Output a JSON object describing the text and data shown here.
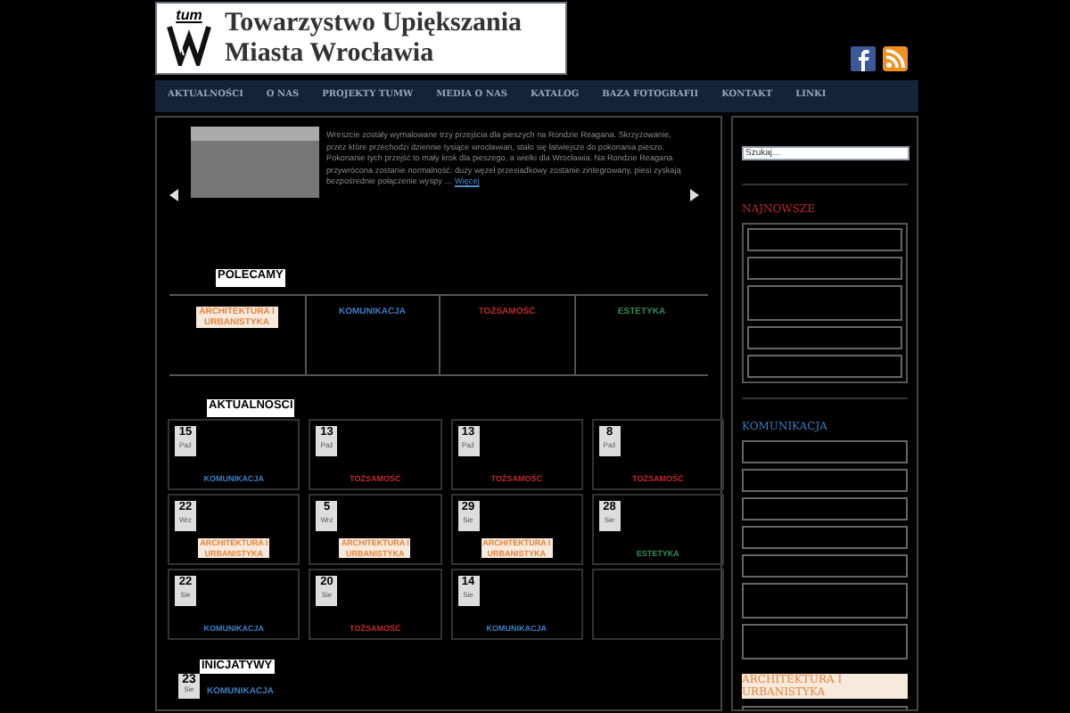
{
  "header": {
    "logo_text": "tum",
    "title_line_1": "Towarzystwo Upiększania",
    "title_line_2": "Miasta Wrocławia"
  },
  "nav": [
    "AKTUALNOŚCI",
    "O NAS",
    "PROJEKTY TUMW",
    "MEDIA O NAS",
    "KATALOG",
    "BAZA FOTOGRAFII",
    "KONTAKT",
    "LINKI"
  ],
  "slider": {
    "text": "Wreszcie zostały wymalowane trzy przejścia dla pieszych na Rondzie Reagana. Skrzyżowanie, przez które przechodzi dziennie tysiące wrocławian, stało się łatwiejsze do pokonania pieszo. Pokonanie tych przejść to mały krok dla pieszego, a wielki dla Wrocławia. Na Rondzie Reagana przywrócona zostanie normalność: duży węzeł przesiadkowy zostanie zintegrowany, piesi zyskają bezpośrednie połączenie wyspy …",
    "more": "Więcej"
  },
  "recommended": {
    "heading": "POLECAMY",
    "categories": [
      {
        "kind": "architecture",
        "label": "ARCHITEKTURA I URBANISTYKA"
      },
      {
        "kind": "communication",
        "label": "KOMUNIKACJA"
      },
      {
        "kind": "identity",
        "label": "TOŻSAMOŚĆ"
      },
      {
        "kind": "aesthetics",
        "label": "ESTETYKA"
      }
    ]
  },
  "news": {
    "heading": "AKTUALNOSCI",
    "cards": [
      {
        "day": "15",
        "month": "Paź",
        "kind": "communication",
        "category": "KOMUNIKACJA"
      },
      {
        "day": "13",
        "month": "Paź",
        "kind": "identity",
        "category": "TOŻSAMOŚĆ"
      },
      {
        "day": "13",
        "month": "Paź",
        "kind": "identity",
        "category": "TOŻSAMOŚĆ"
      },
      {
        "day": "8",
        "month": "Paź",
        "kind": "identity",
        "category": "TOŻSAMOŚĆ"
      },
      {
        "day": "22",
        "month": "Wrz",
        "kind": "architecture",
        "category": "ARCHITEKTURA I URBANISTYKA"
      },
      {
        "day": "5",
        "month": "Wrz",
        "kind": "architecture",
        "category": "ARCHITEKTURA I URBANISTYKA"
      },
      {
        "day": "29",
        "month": "Sie",
        "kind": "architecture",
        "category": "ARCHITEKTURA I URBANISTYKA"
      },
      {
        "day": "28",
        "month": "Sie",
        "kind": "aesthetics",
        "category": "ESTETYKA"
      },
      {
        "day": "22",
        "month": "Sie",
        "kind": "communication",
        "category": "KOMUNIKACJA"
      },
      {
        "day": "20",
        "month": "Sie",
        "kind": "identity",
        "category": "TOŻSAMOŚĆ"
      },
      {
        "day": "14",
        "month": "Sie",
        "kind": "communication",
        "category": "KOMUNIKACJA"
      }
    ]
  },
  "initiatives": {
    "heading": "INICJATYWY",
    "day": "23",
    "month": "Sie",
    "kind": "communication",
    "category": "KOMUNIKACJA"
  },
  "sidebar": {
    "search": {
      "placeholder": "Szukaj..."
    },
    "sections": [
      {
        "kind": "latest",
        "title": "NAJNOWSZE"
      },
      {
        "kind": "communication",
        "title": "KOMUNIKACJA"
      },
      {
        "kind": "architecture",
        "title": "ARCHITEKTURA I URBANISTYKA"
      }
    ]
  }
}
